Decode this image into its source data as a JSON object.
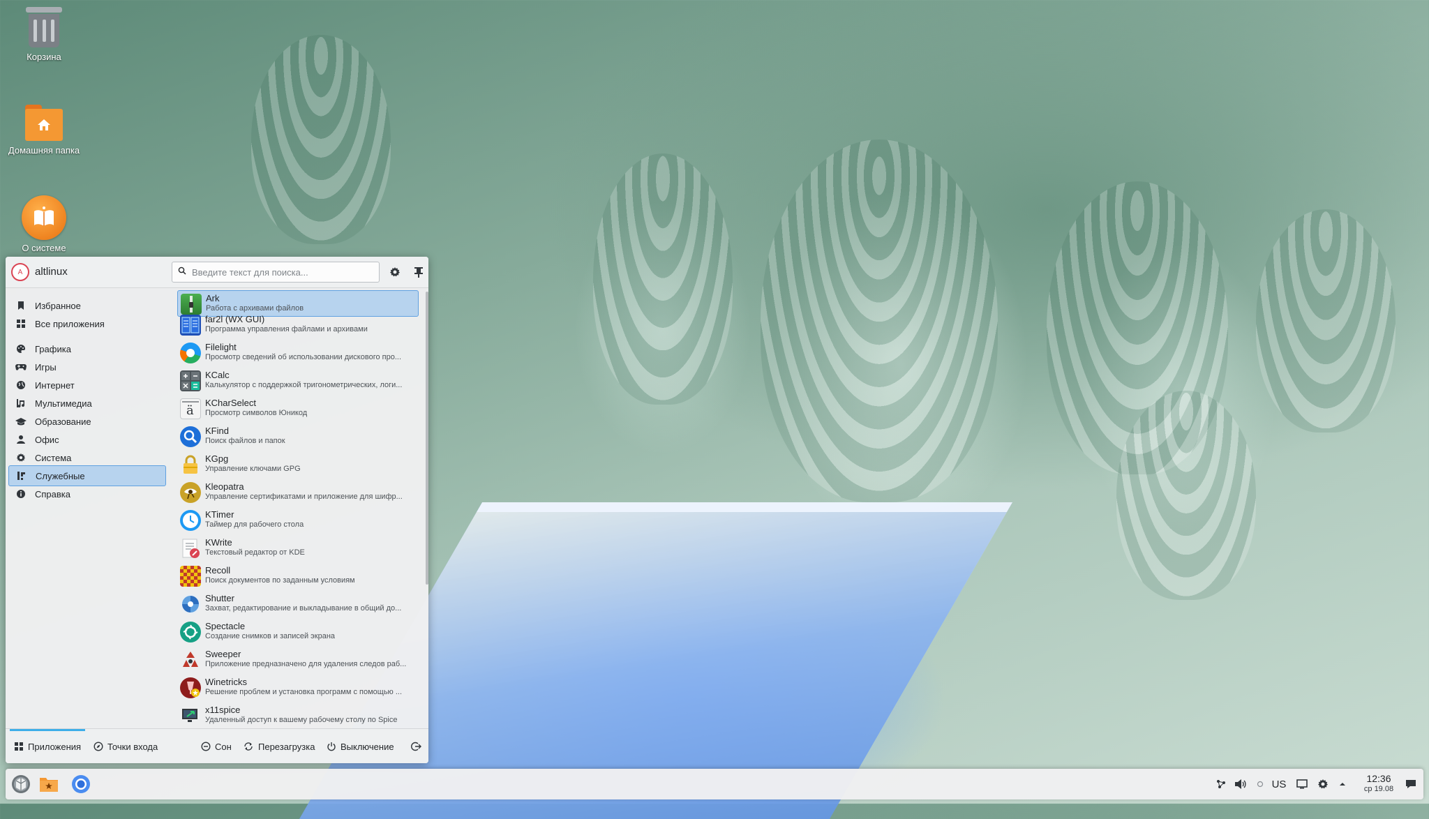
{
  "desktop": {
    "icons": [
      {
        "label": "Корзина",
        "icon": "trash-icon"
      },
      {
        "label": "Домашняя папка",
        "icon": "home-folder-icon"
      },
      {
        "label": "О системе",
        "icon": "about-system-icon"
      }
    ]
  },
  "launcher": {
    "user": {
      "name": "altlinux",
      "avatar_letter": "A"
    },
    "search": {
      "placeholder": "Введите текст для поиска..."
    },
    "categories": [
      {
        "label": "Избранное",
        "icon": "bookmark-icon"
      },
      {
        "label": "Все приложения",
        "icon": "grid-icon"
      },
      {
        "label": "Графика",
        "icon": "palette-icon"
      },
      {
        "label": "Игры",
        "icon": "gamepad-icon"
      },
      {
        "label": "Интернет",
        "icon": "globe-icon"
      },
      {
        "label": "Мультимедиа",
        "icon": "multimedia-icon"
      },
      {
        "label": "Образование",
        "icon": "graduation-cap-icon"
      },
      {
        "label": "Офис",
        "icon": "office-icon"
      },
      {
        "label": "Система",
        "icon": "system-gear-icon"
      },
      {
        "label": "Служебные",
        "icon": "utilities-icon",
        "selected": true
      },
      {
        "label": "Справка",
        "icon": "help-icon"
      }
    ],
    "apps": [
      {
        "name": "Ark",
        "desc": "Работа с архивами файлов",
        "icon": "ark-icon",
        "selected": true
      },
      {
        "name": "far2l (WX GUI)",
        "desc": "Программа управления файлами и архивами",
        "icon": "far2l-icon"
      },
      {
        "name": "Filelight",
        "desc": "Просмотр сведений об использовании дискового про...",
        "icon": "filelight-icon"
      },
      {
        "name": "KCalc",
        "desc": "Калькулятор с поддержкой тригонометрических, логи...",
        "icon": "kcalc-icon"
      },
      {
        "name": "KCharSelect",
        "desc": "Просмотр символов Юникод",
        "icon": "kcharselect-icon"
      },
      {
        "name": "KFind",
        "desc": "Поиск файлов и папок",
        "icon": "kfind-icon"
      },
      {
        "name": "KGpg",
        "desc": "Управление ключами GPG",
        "icon": "kgpg-icon"
      },
      {
        "name": "Kleopatra",
        "desc": "Управление сертификатами и приложение для шифр...",
        "icon": "kleopatra-icon"
      },
      {
        "name": "KTimer",
        "desc": "Таймер для рабочего стола",
        "icon": "ktimer-icon"
      },
      {
        "name": "KWrite",
        "desc": "Текстовый редактор от KDE",
        "icon": "kwrite-icon"
      },
      {
        "name": "Recoll",
        "desc": "Поиск документов по заданным условиям",
        "icon": "recoll-icon"
      },
      {
        "name": "Shutter",
        "desc": "Захват, редактирование и выкладывание в общий до...",
        "icon": "shutter-icon"
      },
      {
        "name": "Spectacle",
        "desc": "Создание снимков и записей экрана",
        "icon": "spectacle-icon"
      },
      {
        "name": "Sweeper",
        "desc": "Приложение предназначено для удаления следов раб...",
        "icon": "sweeper-icon"
      },
      {
        "name": "Winetricks",
        "desc": "Решение проблем и установка программ с помощью ...",
        "icon": "winetricks-icon"
      },
      {
        "name": "x11spice",
        "desc": "Удаленный доступ к вашему рабочему столу по Spice",
        "icon": "x11spice-icon"
      }
    ],
    "footer": {
      "applications": "Приложения",
      "places": "Точки входа",
      "sleep": "Сон",
      "restart": "Перезагрузка",
      "shutdown": "Выключение"
    }
  },
  "panel": {
    "keyboard_layout": "US",
    "time": "12:36",
    "date": "ср 19.08"
  },
  "colors": {
    "accent": "#3daee9",
    "selection": "#b7d3ee",
    "panel_bg": "#eff0f1"
  }
}
